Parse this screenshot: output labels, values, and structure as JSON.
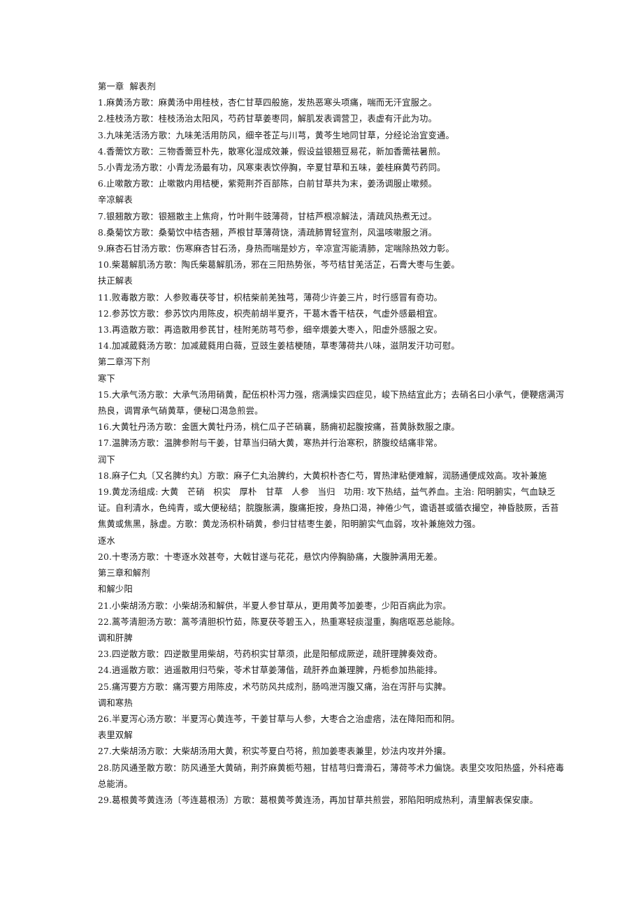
{
  "document": {
    "page_background": "#ffffff",
    "text_color": "#1a1a1a",
    "lines": [
      {
        "id": "l1",
        "kind": "chapter",
        "text": "第一章  解表剂"
      },
      {
        "id": "l2",
        "kind": "entry",
        "text": "1.麻黄汤方歌：麻黄汤中用桂枝，杏仁甘草四般施，发热恶寒头项痛，喘而无汗宜服之。"
      },
      {
        "id": "l3",
        "kind": "entry",
        "text": "2.桂枝汤方歌：桂枝汤治太阳风，芍药甘草姜枣同，解肌发表调营卫，表虚有汗此为功。"
      },
      {
        "id": "l4",
        "kind": "entry",
        "text": "3.九味羌活汤方歌：九味羌活用防风，细辛苍芷与川芎，黄芩生地同甘草，分经论治宜变通。"
      },
      {
        "id": "l5",
        "kind": "entry",
        "text": "4.香薷饮方歌：三物香薷豆朴先，散寒化湿成效兼，假设益银翘豆易花，新加香薷祛暑煎。"
      },
      {
        "id": "l6",
        "kind": "entry",
        "text": "5.小青龙汤方歌：小青龙汤最有功，风寒束表饮停胸，辛夏甘草和五味，姜桂麻黄芍药同。"
      },
      {
        "id": "l7",
        "kind": "entry",
        "text": "6.止嗽散方歌：止嗽散内用桔梗，紫菀荆芥百部陈，白前甘草共为末，姜汤调服止嗽频。"
      },
      {
        "id": "l8",
        "kind": "subhead",
        "text": "辛凉解表"
      },
      {
        "id": "l9",
        "kind": "entry",
        "text": "7.银翘散方歌：银翘散主上焦疴，竹叶荆牛豉薄荷，甘桔芦根凉解法，清疏风热煮无过。"
      },
      {
        "id": "l10",
        "kind": "entry",
        "text": "8.桑菊饮方歌：桑菊饮中桔杏翘，芦根甘草薄荷饶，清疏肺胃轻宣剂，风温咳嗽服之消。"
      },
      {
        "id": "l11",
        "kind": "entry",
        "text": "9.麻杏石甘汤方歌：伤寒麻杏甘石汤，身热而喘是妙方，辛凉宣泻能清肺，定喘除热效力彰。"
      },
      {
        "id": "l12",
        "kind": "entry",
        "text": "10.柴葛解肌汤方歌：陶氏柴葛解肌汤，邪在三阳热势张，芩芍桔甘羌活芷，石膏大枣与生姜。"
      },
      {
        "id": "l13",
        "kind": "subhead",
        "text": "扶正解表"
      },
      {
        "id": "l14",
        "kind": "entry",
        "text": "11.败毒散方歌：人参败毒茯苓甘，枳桔柴前羌独芎，薄荷少许姜三片，时行感冒有奇功。"
      },
      {
        "id": "l15",
        "kind": "entry",
        "text": "12.参苏饮方歌：参苏饮内用陈皮，枳壳前胡半夏齐，干葛木香干桔茯，气虚外感最相宜。"
      },
      {
        "id": "l16",
        "kind": "entry",
        "text": "13.再造散方歌：再造散用参芪甘，桂附羌防芎芍参，细辛煨姜大枣入，阳虚外感服之安。"
      },
      {
        "id": "l17",
        "kind": "entry",
        "text": "14.加减葳蕤汤方歌：加减葳蕤用白薇，豆豉生姜桔梗随，草枣薄荷共八味，滋阴发汗功可慰。"
      },
      {
        "id": "l18",
        "kind": "chapter",
        "text": "第二章泻下剂"
      },
      {
        "id": "l19",
        "kind": "subhead",
        "text": "寒下"
      },
      {
        "id": "l20",
        "kind": "para-15",
        "text": "15.大承气汤方歌：大承气汤用硝黄，配伍枳朴泻力强，痞满燥实四症见，峻下热结宜此方；去硝名曰小承气，便鞕痞满泻热良，调胃承气硝黄草，便秘口渴急煎尝。"
      },
      {
        "id": "l21",
        "kind": "entry",
        "text": "16.大黄牡丹汤方歌：金匮大黄牡丹汤，桃仁瓜子芒硝襄，肠痈初起腹按痛，苔黄脉数服之康。"
      },
      {
        "id": "l22",
        "kind": "entry",
        "text": "17.温脾汤方歌：温脾参附与干姜，甘草当归硝大黄，寒热并行治寒积，脐腹绞结痛非常。"
      },
      {
        "id": "l23",
        "kind": "subhead",
        "text": "润下"
      },
      {
        "id": "l24",
        "kind": "entry",
        "text": "18.麻子仁丸〔又名脾约丸〕方歌：麻子仁丸治脾约，大黄枳朴杏仁芍，胃热津粘便难解，润肠通便成效高。攻补兼施"
      },
      {
        "id": "l25",
        "kind": "para",
        "text": "19.黄龙汤组成: 大黄　芒硝　枳实　厚朴　甘草　人参　当归　功用: 攻下热结，益气养血。主治: 阳明腑实，气血缺乏证。自利清水，色纯青，或大便秘结；脘腹胀满，腹痛拒按，身热口渴，神倦少气，谵语甚或循衣撮空，神昏肢厥，舌苔焦黄或焦黑，脉虚。方歌：黄龙汤枳朴硝黄，参归甘桔枣生姜，阳明腑实气血弱，攻补兼施效力强。"
      },
      {
        "id": "l26",
        "kind": "subhead",
        "text": "逐水"
      },
      {
        "id": "l27",
        "kind": "entry",
        "text": "20.十枣汤方歌：十枣逐水效甚夸，大戟甘遂与花花，悬饮内停胸胁痛，大腹肿满用无差。"
      },
      {
        "id": "l28",
        "kind": "chapter",
        "text": "第三章和解剂"
      },
      {
        "id": "l29",
        "kind": "subhead",
        "text": "和解少阳"
      },
      {
        "id": "l30",
        "kind": "entry",
        "text": "21.小柴胡汤方歌：小柴胡汤和解供，半夏人参甘草从，更用黄芩加姜枣，少阳百病此为宗。"
      },
      {
        "id": "l31",
        "kind": "entry",
        "text": "22.蒿芩清胆汤方歌：蒿芩清胆枳竹茹，陈夏茯苓碧玉入，热重寒轻痰湿重，胸痞呕恶总能除。"
      },
      {
        "id": "l32",
        "kind": "subhead",
        "text": "调和肝脾"
      },
      {
        "id": "l33",
        "kind": "entry",
        "text": "23.四逆散方歌：四逆散里用柴胡，芍药枳实甘草须，此是阳郁成厥逆，疏肝理脾奏效奇。"
      },
      {
        "id": "l34",
        "kind": "entry",
        "text": "24.逍遥散方歌：逍遥散用归芍柴，苓术甘草姜薄偕，疏肝养血兼理脾，丹栀参加热能排。"
      },
      {
        "id": "l35",
        "kind": "entry",
        "text": "25.痛泻要方方歌：痛泻要方用陈皮，术芍防风共成剂，肠鸣泄泻腹又痛，治在泻肝与实脾。"
      },
      {
        "id": "l36",
        "kind": "subhead",
        "text": "调和寒热"
      },
      {
        "id": "l37",
        "kind": "entry",
        "text": "26.半夏泻心汤方歌：半夏泻心黄连芩，干姜甘草与人参，大枣合之治虚痞，法在降阳而和阴。"
      },
      {
        "id": "l38",
        "kind": "subhead",
        "text": "表里双解"
      },
      {
        "id": "l39",
        "kind": "entry",
        "text": "27.大柴胡汤方歌：大柴胡汤用大黄，积实芩夏白芍将，煎加姜枣表兼里，妙法内攻并外攘。"
      },
      {
        "id": "l40",
        "kind": "entry",
        "text": "28.防风通圣散方歌：防风通圣大黄硝，荆芥麻黄栀芍翘，甘桔芎归膏滑石，薄荷芩术力偏饶。表里交攻阳热盛，外科疮毒总能消。"
      },
      {
        "id": "l41",
        "kind": "entry",
        "text": "29.葛根黄芩黄连汤〔芩连葛根汤〕方歌：葛根黄芩黄连汤，再加甘草共煎尝，邪陷阳明成热利，清里解表保安康。"
      }
    ]
  }
}
